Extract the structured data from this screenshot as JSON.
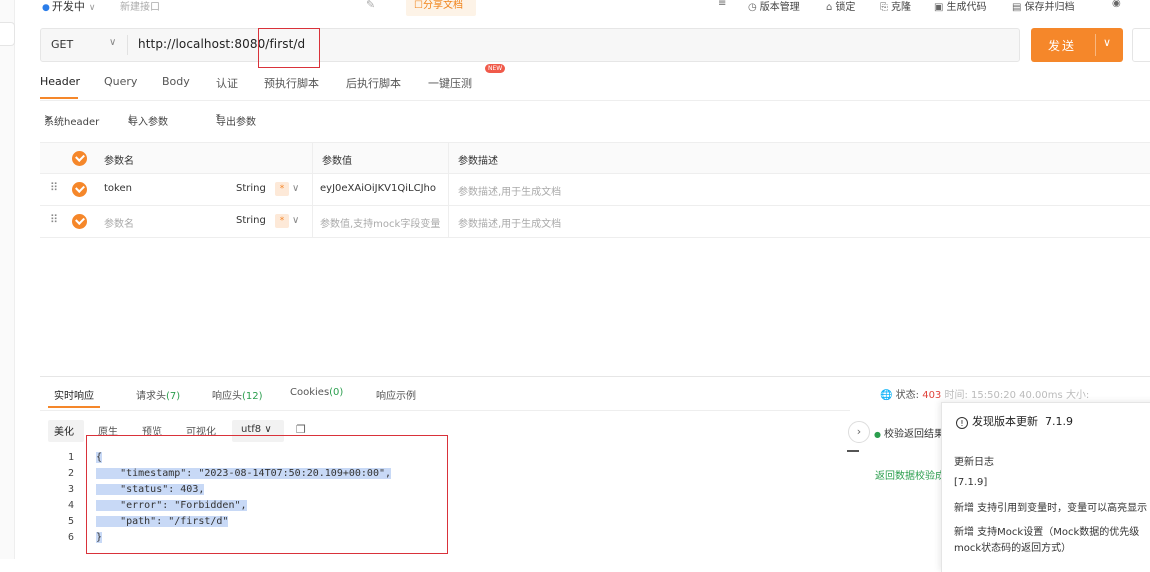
{
  "topbar": {
    "env_label": "开发中",
    "new_tab_placeholder": "新建接口",
    "share_label": "分享文档",
    "tools": [
      {
        "icon": "≡",
        "label": ""
      },
      {
        "icon": "◷",
        "label": "版本管理"
      },
      {
        "icon": "⌂",
        "label": "锁定"
      },
      {
        "icon": "⎘",
        "label": "克隆"
      },
      {
        "icon": "▣",
        "label": "生成代码"
      },
      {
        "icon": "▤",
        "label": "保存并归档"
      },
      {
        "icon": "◉",
        "label": ""
      }
    ]
  },
  "request": {
    "method": "GET",
    "url": "http://localhost:8080/first/d",
    "send_label": "发送"
  },
  "request_tabs": [
    "Header",
    "Query",
    "Body",
    "认证",
    "预执行脚本",
    "后执行脚本",
    "一键压测"
  ],
  "new_badge": "NEW",
  "header_tools": {
    "system_header": "系统header",
    "import": "导入参数",
    "export": "导出参数"
  },
  "params_table": {
    "columns": [
      "参数名",
      "参数值",
      "参数描述"
    ],
    "rows": [
      {
        "name": "token",
        "type": "String",
        "required_mark": "*",
        "value": "eyJ0eXAiOiJKV1QiLCJho",
        "desc": "参数描述,用于生成文档",
        "placeholder_name": false
      },
      {
        "name": "参数名",
        "type": "String",
        "required_mark": "*",
        "value": "参数值,支持mock字段变量",
        "desc": "参数描述,用于生成文档",
        "placeholder_name": true
      }
    ]
  },
  "response_tabs": [
    {
      "label": "实时响应",
      "count": ""
    },
    {
      "label": "请求头",
      "count": "(7)"
    },
    {
      "label": "响应头",
      "count": "(12)"
    },
    {
      "label": "Cookies",
      "count": "(0)"
    },
    {
      "label": "响应示例",
      "count": ""
    }
  ],
  "status_bar": {
    "status_label": "状态:",
    "status_code": "403",
    "time_label": "时间:",
    "time_value": "15:50:20",
    "duration": "40.00ms",
    "size_label": "大小:"
  },
  "view_modes": [
    "美化",
    "原生",
    "预览",
    "可视化"
  ],
  "encoding": "utf8",
  "code_lines": [
    "{",
    "    \"timestamp\": \"2023-08-14T07:50:20.109+00:00\",",
    "    \"status\": 403,",
    "    \"error\": \"Forbidden\",",
    "    \"path\": \"/first/d\"",
    "}"
  ],
  "verify": {
    "title": "校验返回结果",
    "subtitle": "返回数据校验成功"
  },
  "update_popup": {
    "title": "发现版本更新",
    "version": "7.1.9",
    "changelog_title": "更新日志",
    "version_tag": "[7.1.9]",
    "line1": "新增 支持引用到变量时，变量可以高亮显示",
    "line2": "新增 支持Mock设置（Mock数据的优先级",
    "line3": "mock状态码的返回方式）"
  },
  "colors": {
    "accent": "#f5872a",
    "highlight_box": "#d9323a",
    "selection": "#c8d9f6"
  }
}
